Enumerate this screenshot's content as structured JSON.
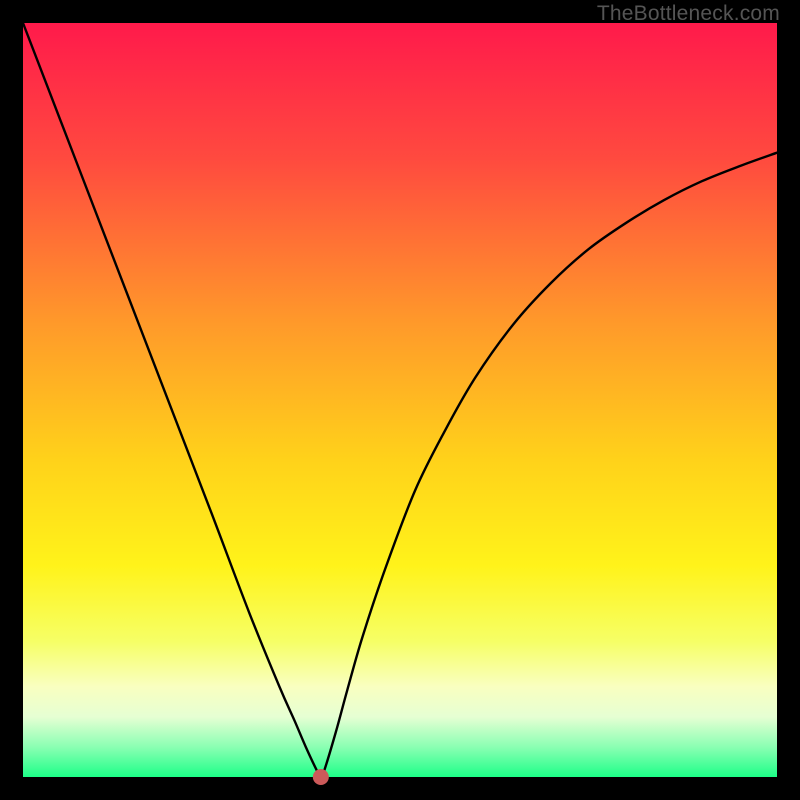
{
  "watermark": "TheBottleneck.com",
  "gradient_stops": [
    {
      "offset": 0,
      "color": "#ff1a4b"
    },
    {
      "offset": 18,
      "color": "#ff4a3f"
    },
    {
      "offset": 40,
      "color": "#ff9a2a"
    },
    {
      "offset": 58,
      "color": "#ffd21a"
    },
    {
      "offset": 72,
      "color": "#fff31a"
    },
    {
      "offset": 82,
      "color": "#f6ff66"
    },
    {
      "offset": 88,
      "color": "#f9ffc0"
    },
    {
      "offset": 92,
      "color": "#e6ffd3"
    },
    {
      "offset": 96,
      "color": "#8bffb3"
    },
    {
      "offset": 100,
      "color": "#1dff88"
    }
  ],
  "point": {
    "x_pct": 0.395,
    "y_pct": 0.0,
    "color": "#cc5a5a",
    "r": 8
  },
  "chart_data": {
    "type": "line",
    "title": "",
    "xlabel": "",
    "ylabel": "",
    "xlim": [
      0,
      1
    ],
    "ylim": [
      0,
      1
    ],
    "x": [
      0.0,
      0.05,
      0.1,
      0.15,
      0.2,
      0.25,
      0.3,
      0.34,
      0.36,
      0.375,
      0.39,
      0.395,
      0.4,
      0.415,
      0.43,
      0.45,
      0.48,
      0.52,
      0.56,
      0.6,
      0.65,
      0.7,
      0.75,
      0.8,
      0.85,
      0.9,
      0.95,
      1.0
    ],
    "values": [
      1.0,
      0.87,
      0.74,
      0.61,
      0.48,
      0.35,
      0.218,
      0.12,
      0.075,
      0.04,
      0.008,
      0.0,
      0.01,
      0.06,
      0.115,
      0.185,
      0.275,
      0.38,
      0.46,
      0.53,
      0.6,
      0.655,
      0.7,
      0.735,
      0.765,
      0.79,
      0.81,
      0.828
    ],
    "series_name": "bottleneck-curve",
    "minimum_point": {
      "x": 0.395,
      "y": 0.0
    }
  }
}
